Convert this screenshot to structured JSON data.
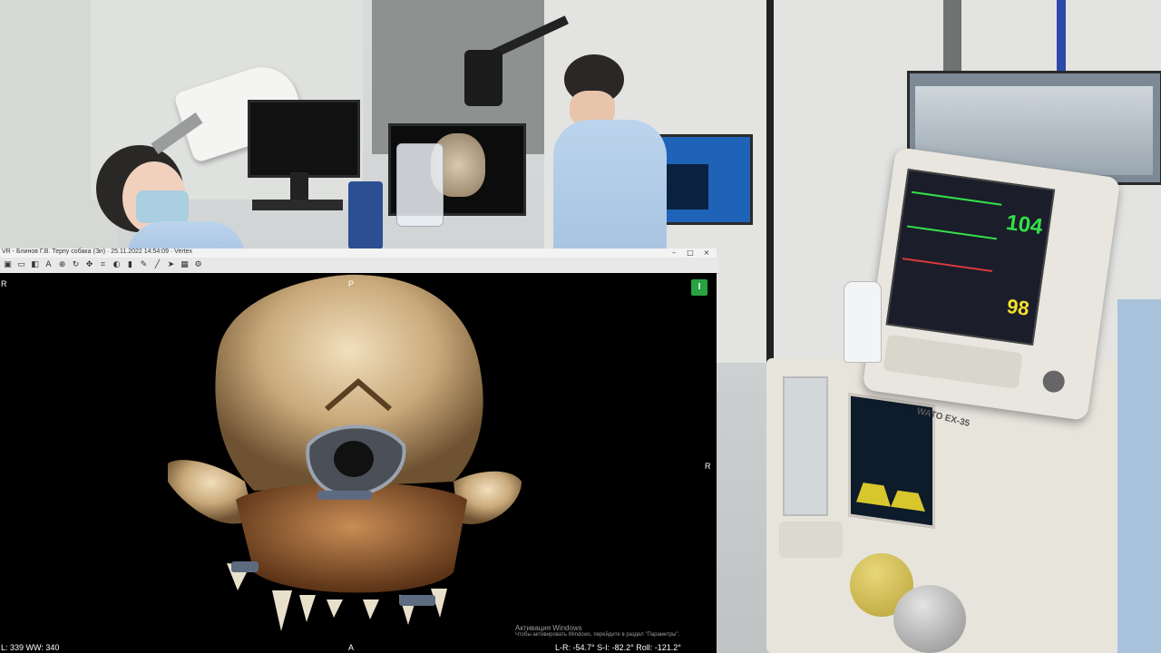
{
  "viewer": {
    "title": "VR - Блинов Г.В. Терпу собака (Эл) · 25.11.2022 14:54:09 · Vertex",
    "window_buttons": [
      "–",
      "□",
      "×"
    ],
    "toolbar_icons": [
      "save-icon",
      "layout-icon",
      "annotate-icon",
      "text-icon",
      "zoom-icon",
      "rotate-icon",
      "pan-icon",
      "crop-icon",
      "contrast-icon",
      "measure-icon",
      "pen-icon",
      "line-icon",
      "arrow-icon",
      "grid-icon",
      "settings-icon"
    ],
    "orientation": {
      "top": "P",
      "left": "R",
      "right": "R",
      "bottom": "A"
    },
    "badge": "I",
    "window_level": "L: 339 WW: 340",
    "rotation_readout": "L-R: -54.7° S-I: -82.2° Roll: -121.2°",
    "activation_title": "Активация Windows",
    "activation_sub": "Чтобы активировать Windows, перейдите в раздел \"Параметры\"."
  },
  "anesthesia": {
    "heart_rate": "104",
    "spo2": "98",
    "model_label": "WATO EX-35"
  },
  "colors": {
    "hr_green": "#33e04a",
    "spo2_yellow": "#f4df2a",
    "badge_green": "#27a341"
  }
}
